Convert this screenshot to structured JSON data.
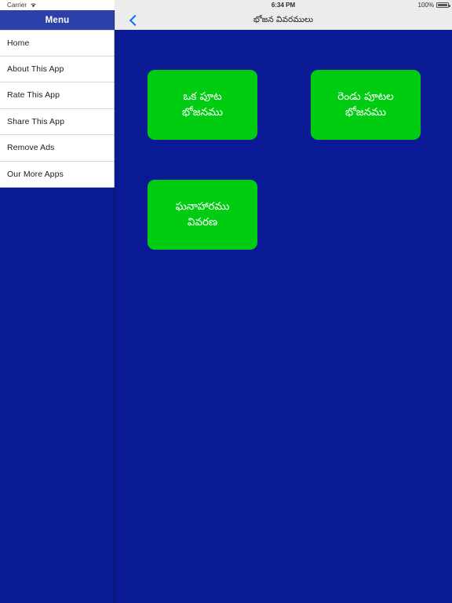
{
  "status_bar": {
    "carrier": "Carrier",
    "wifi_icon": "wifi-icon",
    "time": "6:34 PM",
    "battery_percent": "100%",
    "battery_icon": "battery-full-icon"
  },
  "sidebar": {
    "header_title": "Menu",
    "items": [
      {
        "label": "Home"
      },
      {
        "label": "About This App"
      },
      {
        "label": "Rate This App"
      },
      {
        "label": "Share This App"
      },
      {
        "label": "Remove Ads"
      },
      {
        "label": "Our More Apps"
      }
    ]
  },
  "nav_bar": {
    "back_icon": "chevron-left-icon",
    "title": "భోజన వివరములు"
  },
  "content": {
    "tiles": [
      {
        "label": "ఒక పూట\nభోజనము"
      },
      {
        "label": "రెండు పూటల\nభోజనము"
      },
      {
        "label": "ఘనాహారము\nవివరణ"
      }
    ]
  },
  "colors": {
    "background": "#0a1a94",
    "sidebar_header": "#2d3fa8",
    "sidebar_list": "#ffffff",
    "nav_bar": "#ececec",
    "tile": "#00cc11",
    "accent_blue": "#0a6ef0"
  }
}
